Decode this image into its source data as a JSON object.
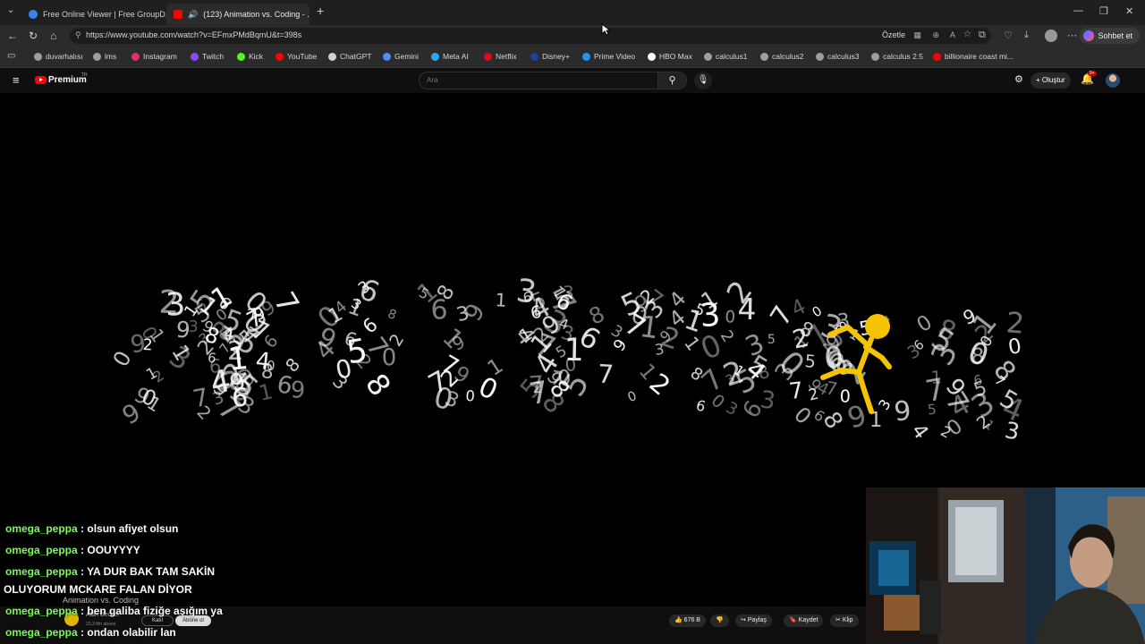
{
  "browser": {
    "tabs": [
      {
        "title": "Free Online Viewer | Free GroupD...",
        "active": false
      },
      {
        "title": "(123) Animation vs. Coding - ...",
        "active": true
      }
    ],
    "url": "https://www.youtube.com/watch?v=EFmxPMdBqmU&t=398s",
    "summarize_label": "Özetle",
    "chat_label": "Sohbet et",
    "bookmarks": [
      {
        "label": "duvarhalısı",
        "icon": "globe-icon",
        "color": "#9e9e9e"
      },
      {
        "label": "lms",
        "icon": "globe-icon",
        "color": "#9e9e9e"
      },
      {
        "label": "Instagram",
        "icon": "instagram-icon",
        "color": "#e1306c"
      },
      {
        "label": "Twitch",
        "icon": "twitch-icon",
        "color": "#9146ff"
      },
      {
        "label": "Kick",
        "icon": "kick-icon",
        "color": "#53fc18"
      },
      {
        "label": "YouTube",
        "icon": "youtube-icon",
        "color": "#ff0000"
      },
      {
        "label": "ChatGPT",
        "icon": "chatgpt-icon",
        "color": "#d0d0d0"
      },
      {
        "label": "Gemini",
        "icon": "gemini-icon",
        "color": "#4f8ef7"
      },
      {
        "label": "Meta AI",
        "icon": "meta-ai-icon",
        "color": "#2ea6ff"
      },
      {
        "label": "Netflix",
        "icon": "netflix-icon",
        "color": "#e50914"
      },
      {
        "label": "Disney+",
        "icon": "disney-icon",
        "color": "#1f3f9e"
      },
      {
        "label": "Prime Video",
        "icon": "prime-video-icon",
        "color": "#1a98ff"
      },
      {
        "label": "HBO Max",
        "icon": "hbo-max-icon",
        "color": "#ffffff"
      },
      {
        "label": "calculus1",
        "icon": "globe-icon",
        "color": "#9e9e9e"
      },
      {
        "label": "calculus2",
        "icon": "globe-icon",
        "color": "#9e9e9e"
      },
      {
        "label": "calculus3",
        "icon": "globe-icon",
        "color": "#9e9e9e"
      },
      {
        "label": "calculus 2.5",
        "icon": "globe-icon",
        "color": "#9e9e9e"
      },
      {
        "label": "billionaire coast mi...",
        "icon": "youtube-icon",
        "color": "#ff0000"
      }
    ]
  },
  "youtube": {
    "premium_label": "Premium",
    "region": "TR",
    "search_placeholder": "Ara",
    "create_label": "Oluştur",
    "notification_count": "9+",
    "video_title": "Animation vs. Coding",
    "channel_name": "Alan Becker",
    "channel_subs": "22,3 Mn abone",
    "join_label": "Katıl",
    "subscribe_label": "Abone ol",
    "actions": {
      "likes": "676 B",
      "share": "Paylaş",
      "save": "Kaydet",
      "clip": "Klip"
    }
  },
  "chat": [
    {
      "user": "omega_peppa",
      "message": "olsun afiyet olsun"
    },
    {
      "user": "omega_peppa",
      "message": "OOUYYYY"
    },
    {
      "user": "omega_peppa",
      "message": "YA DUR BAK TAM SAKİN"
    },
    {
      "user": "",
      "message": "OLUYORUM MCKARE FALAN DİYOR"
    },
    {
      "user": "omega_peppa",
      "message": "ben galiba fiziğe aşığım ya"
    },
    {
      "user": "omega_peppa",
      "message": "ondan olabilir lan"
    }
  ],
  "colors": {
    "chat_user": "#7cfc5a",
    "stick_figure": "#f5c400",
    "yt_red": "#ff0000"
  }
}
